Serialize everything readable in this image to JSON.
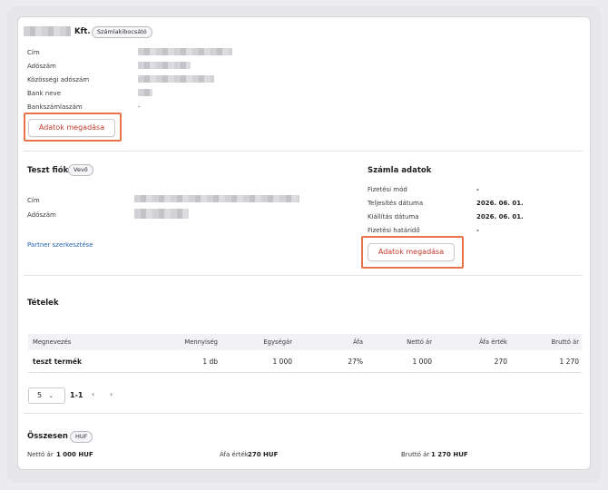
{
  "company": {
    "name_suffix": "Kft.",
    "badge": "Számlakibocsátó"
  },
  "company_fields": {
    "address_label": "Cím",
    "tax_label": "Adószám",
    "eu_tax_label": "Közösségi adószám",
    "bank_name_label": "Bank neve",
    "bank_account_label": "Bankszámlaszám",
    "bank_account_value": "-"
  },
  "company_button": "Adatok megadása",
  "partner": {
    "name": "Teszt fiók",
    "badge": "Vevő",
    "address_label": "Cím",
    "tax_label": "Adószám",
    "edit_link": "Partner szerkesztése"
  },
  "invoice": {
    "title": "Számla adatok",
    "rows": [
      {
        "label": "Fizetési mód",
        "value": "-"
      },
      {
        "label": "Teljesítés dátuma",
        "value": "2026. 06. 01."
      },
      {
        "label": "Kiállítás dátuma",
        "value": "2026. 06. 01."
      },
      {
        "label": "Fizetési határidő",
        "value": "-"
      }
    ],
    "button": "Adatok megadása"
  },
  "items": {
    "title": "Tételek",
    "columns": [
      "Megnevezés",
      "Mennyiség",
      "Egységár",
      "Áfa",
      "Nettó ár",
      "Áfa érték",
      "Bruttó ár"
    ],
    "rows": [
      {
        "name": "teszt termék",
        "quantity": "1 db",
        "unit_price": "1 000",
        "vat": "27%",
        "net": "1 000",
        "vat_amount": "270",
        "gross": "1 270"
      }
    ]
  },
  "pagination": {
    "page_size": "5",
    "range": "1-1",
    "prev_icon": "chevron-left-icon",
    "next_icon": "chevron-right-icon"
  },
  "totals": {
    "title": "Összesen",
    "currency_badge": "HUF",
    "net_label": "Nettó ár",
    "net_value": "1 000 HUF",
    "vat_label": "Áfa érték",
    "vat_value": "270 HUF",
    "gross_label": "Bruttó ár",
    "gross_value": "1 270 HUF"
  },
  "colors": {
    "accent_button_text": "#c0392b",
    "highlight": "#e8734a",
    "link": "#2563b0"
  }
}
